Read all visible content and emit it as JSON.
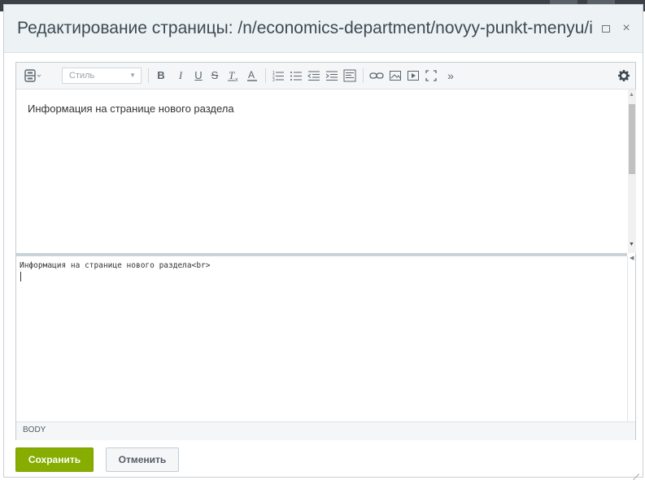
{
  "dialog": {
    "title": "Редактирование страницы: /n/economics-department/novyy-punkt-menyu/index.php",
    "maximize_icon": "square-outline-icon",
    "close_symbol": "×"
  },
  "toolbar": {
    "style_label": "Стиль",
    "more_symbol": "»"
  },
  "editor": {
    "content_text": "Информация на странице нового раздела",
    "source_text": "Информация на странице нового раздела<br>",
    "path_label": "BODY"
  },
  "buttons": {
    "save": "Сохранить",
    "cancel": "Отменить"
  },
  "colors": {
    "save_green": "#86ad00",
    "title_bar": "#edf2f4",
    "toolbar_bg": "#f4f6f7"
  }
}
